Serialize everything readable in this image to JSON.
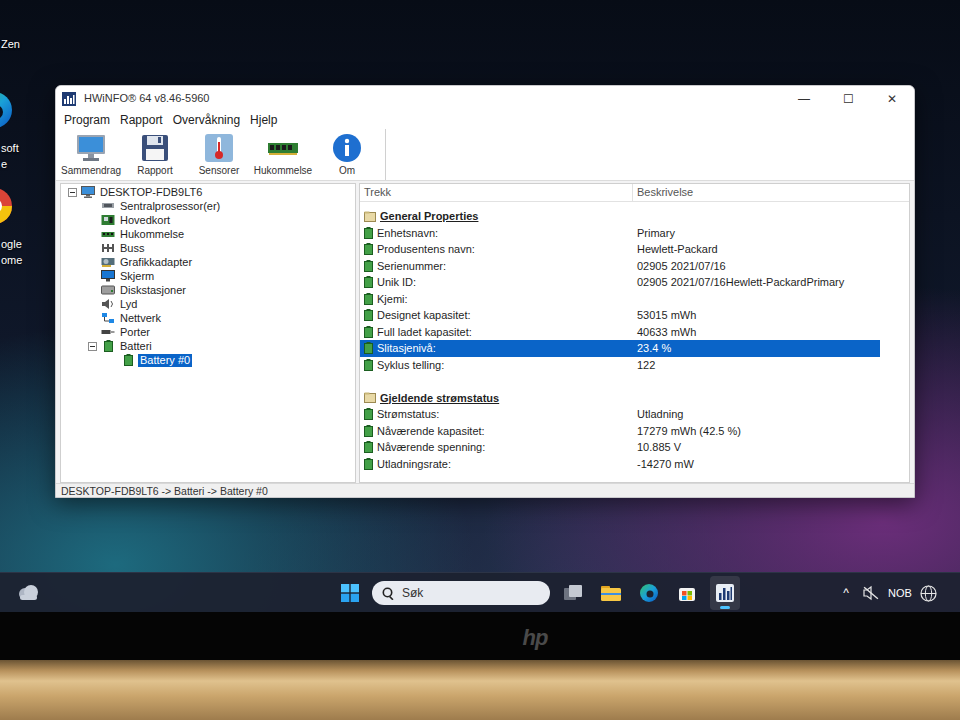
{
  "desktop_icons": [
    {
      "kind": "zen",
      "label_lines": [
        "Zen"
      ]
    },
    {
      "kind": "edge",
      "label_lines": [
        "soft",
        "e"
      ]
    },
    {
      "kind": "chrome",
      "label_lines": [
        "ogle",
        "ome"
      ]
    }
  ],
  "window": {
    "title": "HWiNFO® 64 v8.46-5960",
    "controls": [
      "—",
      "☐",
      "✕"
    ]
  },
  "menu": [
    "Program",
    "Rapport",
    "Overvåkning",
    "Hjelp"
  ],
  "toolbar": [
    {
      "kind": "summary",
      "label": "Sammendrag"
    },
    {
      "kind": "report",
      "label": "Rapport"
    },
    {
      "kind": "sensors",
      "label": "Sensorer"
    },
    {
      "kind": "memory",
      "label": "Hukommelse"
    },
    {
      "kind": "about",
      "label": "Om"
    }
  ],
  "tree": [
    {
      "label": "DESKTOP-FDB9LT6",
      "kind": "computer",
      "expanded": true,
      "selected": false,
      "children": [
        {
          "label": "Sentralprosessor(er)",
          "kind": "cpu",
          "expanded": false,
          "selected": false
        },
        {
          "label": "Hovedkort",
          "kind": "board",
          "expanded": false,
          "selected": false
        },
        {
          "label": "Hukommelse",
          "kind": "memory",
          "expanded": false,
          "selected": false
        },
        {
          "label": "Buss",
          "kind": "bus",
          "expanded": false,
          "selected": false
        },
        {
          "label": "Grafikkadapter",
          "kind": "gpu",
          "expanded": false,
          "selected": false
        },
        {
          "label": "Skjerm",
          "kind": "display",
          "expanded": false,
          "selected": false
        },
        {
          "label": "Diskstasjoner",
          "kind": "disk",
          "expanded": false,
          "selected": false
        },
        {
          "label": "Lyd",
          "kind": "sound",
          "expanded": false,
          "selected": false
        },
        {
          "label": "Nettverk",
          "kind": "network",
          "expanded": false,
          "selected": false
        },
        {
          "label": "Porter",
          "kind": "ports",
          "expanded": false,
          "selected": false
        },
        {
          "label": "Batteri",
          "kind": "battery",
          "expanded": true,
          "selected": false,
          "children": [
            {
              "label": "Battery #0",
              "kind": "battery",
              "selected": true
            }
          ]
        }
      ]
    }
  ],
  "table": {
    "columns": [
      "Trekk",
      "Beskrivelse"
    ],
    "sections": [
      {
        "title": "General Properties",
        "rows": [
          {
            "label": "Enhetsnavn:",
            "value": "Primary",
            "selected": false
          },
          {
            "label": "Produsentens navn:",
            "value": "Hewlett-Packard",
            "selected": false
          },
          {
            "label": "Serienummer:",
            "value": "02905 2021/07/16",
            "selected": false
          },
          {
            "label": "Unik ID:",
            "value": "02905 2021/07/16Hewlett-PackardPrimary",
            "selected": false
          },
          {
            "label": "Kjemi:",
            "selected": false
          },
          {
            "label": "Designet kapasitet:",
            "value": "53015 mWh",
            "selected": false
          },
          {
            "label": "Full ladet kapasitet:",
            "value": "40633 mWh",
            "selected": false
          },
          {
            "label": "Slitasjenivå:",
            "value": "23.4 %",
            "selected": true
          },
          {
            "label": "Syklus telling:",
            "value": "122",
            "selected": false
          }
        ]
      },
      {
        "title": "Gjeldende strømstatus",
        "rows": [
          {
            "label": "Strømstatus:",
            "value": "Utladning",
            "selected": false
          },
          {
            "label": "Nåværende kapasitet:",
            "value": "17279 mWh (42.5 %)",
            "selected": false
          },
          {
            "label": "Nåværende spenning:",
            "value": "10.885 V",
            "selected": false
          },
          {
            "label": "Utladningsrate:",
            "value": "-14270 mW",
            "selected": false
          }
        ]
      }
    ]
  },
  "status_bar": "DESKTOP-FDB9LT6 -> Batteri -> Battery #0",
  "taskbar": {
    "search": {
      "placeholder": "Søk"
    },
    "apps": [
      {
        "kind": "taskview",
        "selected": false
      },
      {
        "kind": "explorer",
        "selected": false
      },
      {
        "kind": "edge",
        "selected": false
      },
      {
        "kind": "store",
        "selected": false
      },
      {
        "kind": "hwinfo",
        "selected": true
      }
    ],
    "tray": {
      "chevron": "^",
      "language": "NOB"
    }
  },
  "bezel_logo": "hp"
}
